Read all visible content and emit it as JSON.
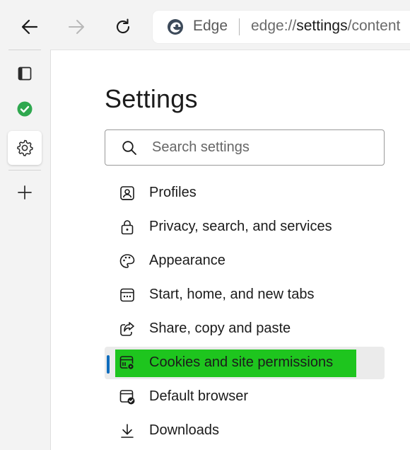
{
  "toolbar": {
    "back_icon": "arrow-left-icon",
    "forward_icon": "arrow-right-icon",
    "refresh_icon": "refresh-icon",
    "browser_label": "Edge",
    "url_prefix": "edge://",
    "url_main": "settings",
    "url_suffix": "/content"
  },
  "sidebar": {
    "items": [
      {
        "icon": "tab-actions-icon",
        "active": false
      },
      {
        "icon": "green-check-icon",
        "active": false
      },
      {
        "icon": "gear-icon",
        "active": true
      },
      {
        "icon": "plus-icon",
        "active": false
      }
    ]
  },
  "settings": {
    "title": "Settings",
    "search_placeholder": "Search settings",
    "menu": [
      {
        "label": "Profiles",
        "icon": "profile-icon"
      },
      {
        "label": "Privacy, search, and services",
        "icon": "lock-icon"
      },
      {
        "label": "Appearance",
        "icon": "palette-icon"
      },
      {
        "label": "Start, home, and new tabs",
        "icon": "start-page-icon"
      },
      {
        "label": "Share, copy and paste",
        "icon": "share-icon"
      },
      {
        "label": "Cookies and site permissions",
        "icon": "cookies-settings-icon",
        "selected": true
      },
      {
        "label": "Default browser",
        "icon": "default-browser-icon"
      },
      {
        "label": "Downloads",
        "icon": "download-icon"
      }
    ]
  },
  "colors": {
    "selection_indicator": "#0f6cbd",
    "selection_highlight": "#1ec51e",
    "check_green": "#2fa84f"
  }
}
